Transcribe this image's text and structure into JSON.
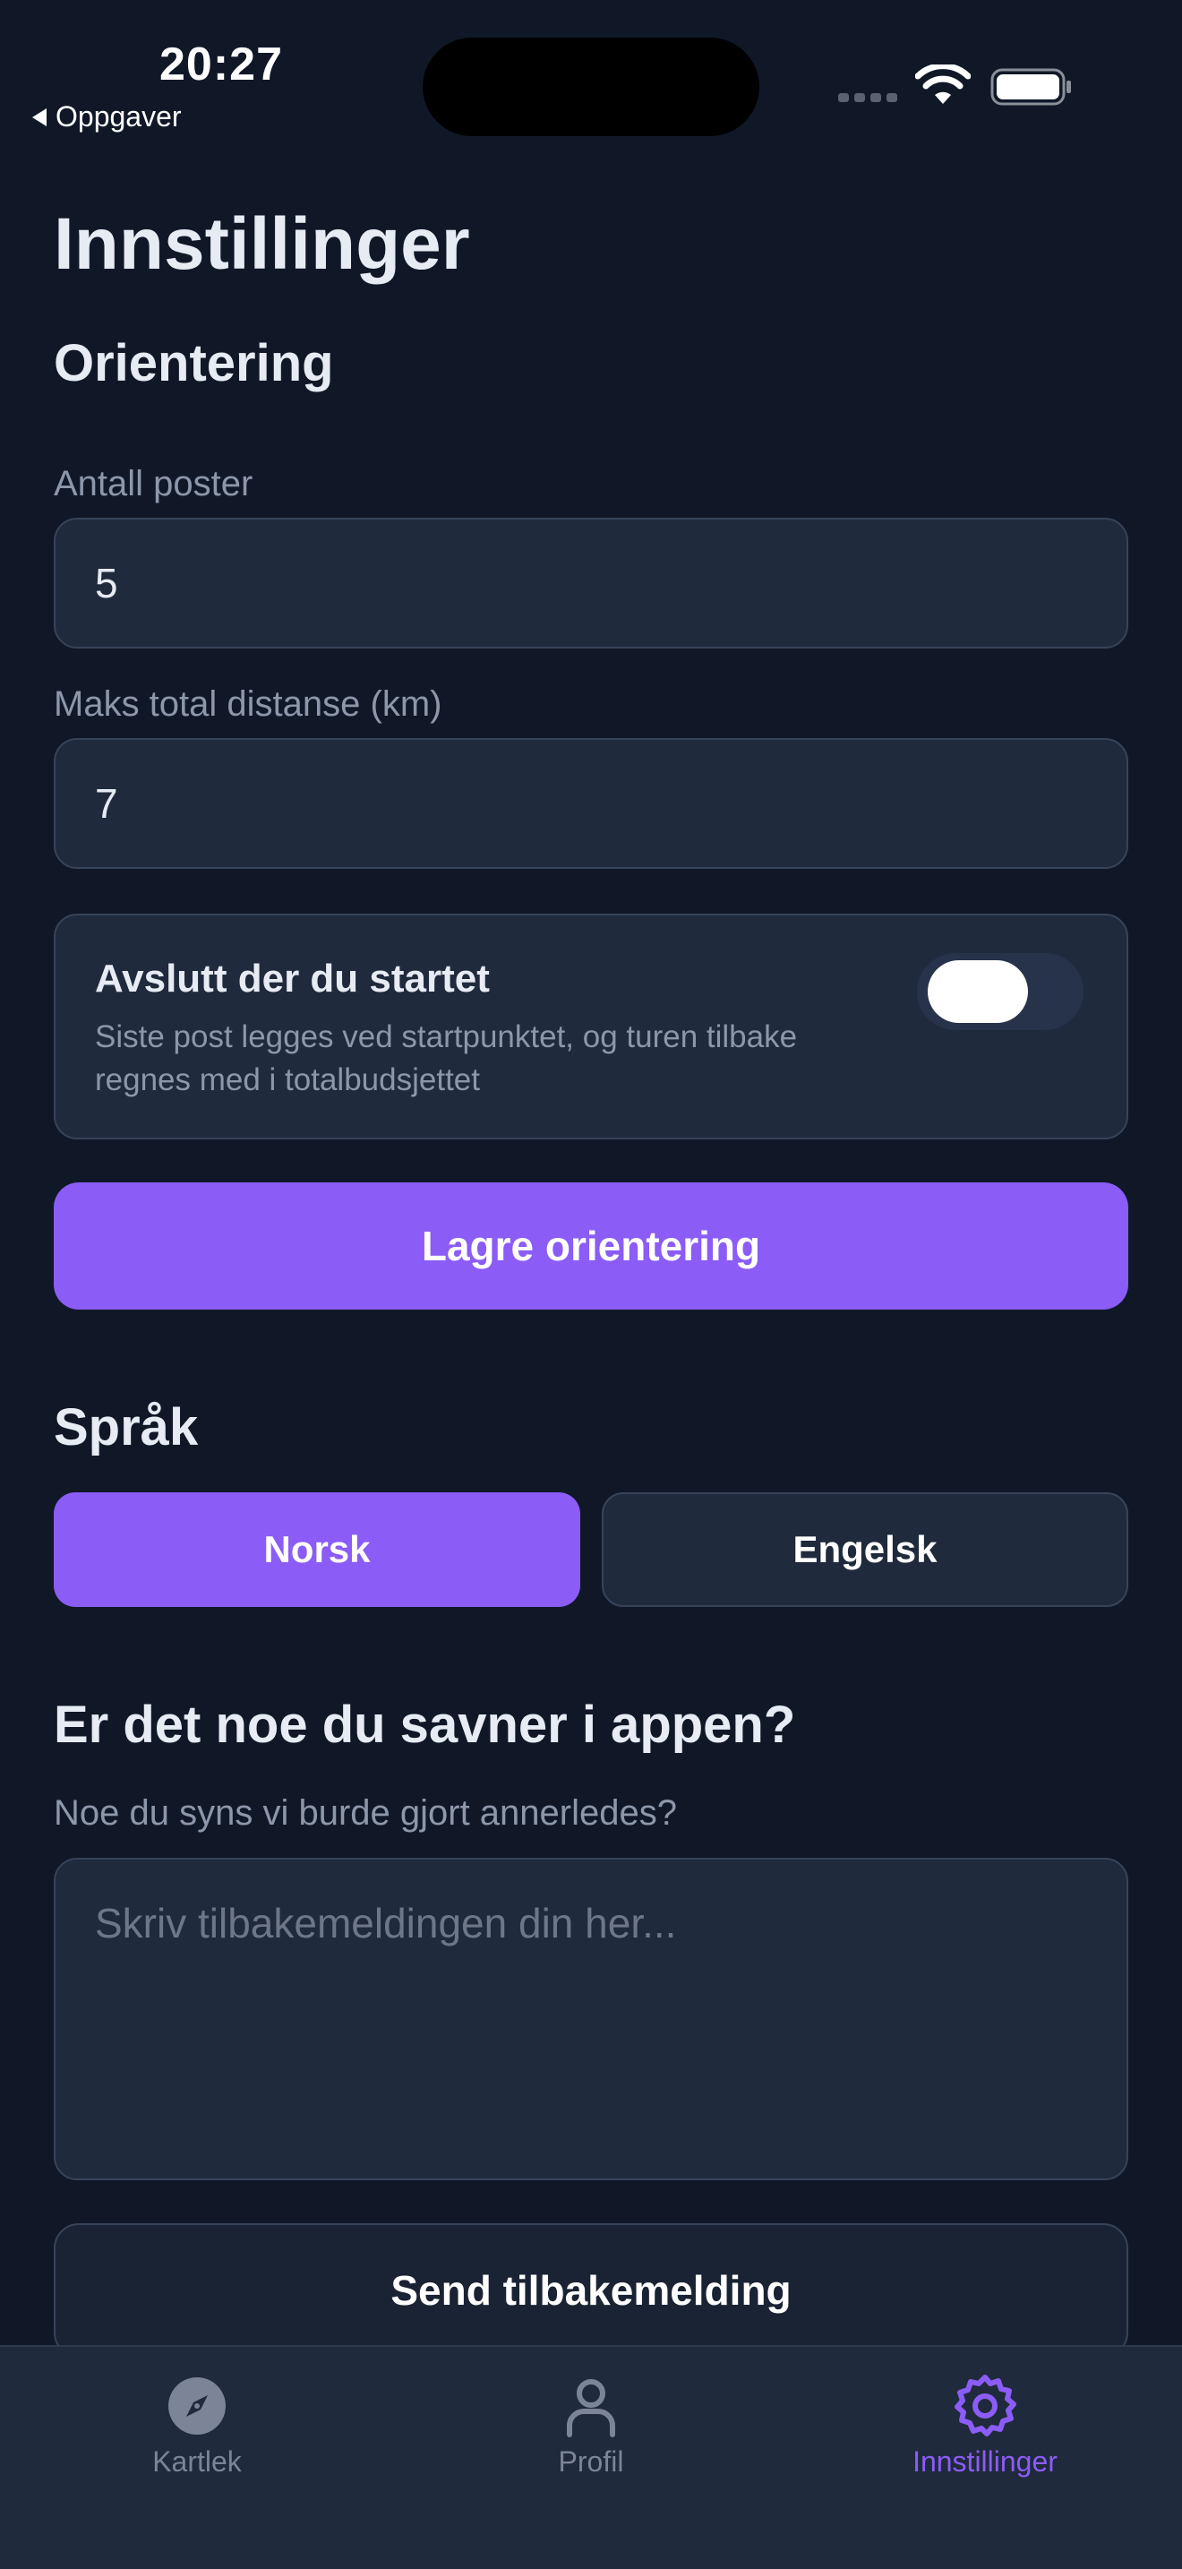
{
  "status_bar": {
    "time": "20:27",
    "back_label": "Oppgaver"
  },
  "page": {
    "title": "Innstillinger"
  },
  "orientation": {
    "heading": "Orientering",
    "posts_label": "Antall poster",
    "posts_value": "5",
    "distance_label": "Maks total distanse (km)",
    "distance_value": "7",
    "end_where_started": {
      "title": "Avslutt der du startet",
      "description": "Siste post legges ved startpunktet, og turen tilbake regnes med i totalbudsjettet",
      "enabled": false
    },
    "save_label": "Lagre orientering"
  },
  "language": {
    "heading": "Språk",
    "options": [
      "Norsk",
      "Engelsk"
    ],
    "selected": "Norsk"
  },
  "feedback": {
    "heading": "Er det noe du savner i appen?",
    "label": "Noe du syns vi burde gjort annerledes?",
    "placeholder": "Skriv tilbakemeldingen din her...",
    "send_label": "Send tilbakemelding"
  },
  "tabbar": {
    "items": [
      {
        "label": "Kartlek",
        "icon": "compass-icon",
        "active": false
      },
      {
        "label": "Profil",
        "icon": "person-icon",
        "active": false
      },
      {
        "label": "Innstillinger",
        "icon": "gear-icon",
        "active": true
      }
    ]
  },
  "colors": {
    "background": "#101828",
    "surface": "#1f2a3c",
    "accent": "#8b5cf6",
    "muted_text": "#8c97aa"
  }
}
